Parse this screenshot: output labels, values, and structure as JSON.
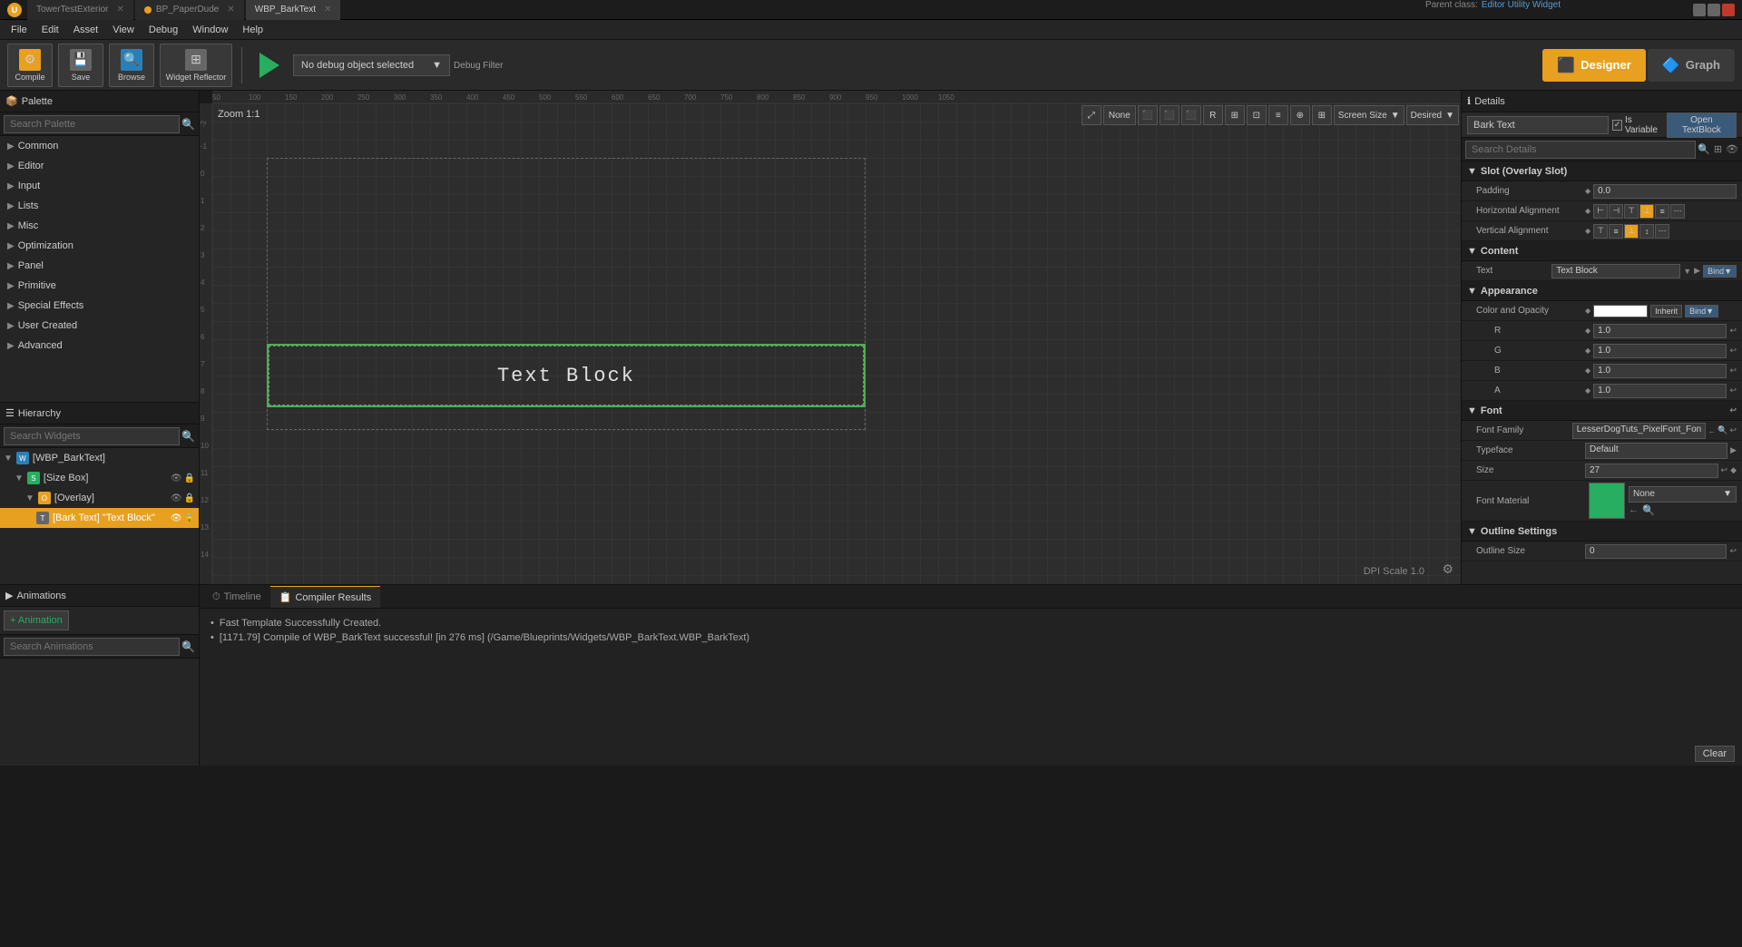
{
  "titlebar": {
    "logo": "U",
    "tabs": [
      {
        "label": "TowerTestExterior",
        "active": false,
        "has_dot": false
      },
      {
        "label": "BP_PaperDude",
        "active": false,
        "has_dot": true
      },
      {
        "label": "WBP_BarkText",
        "active": true,
        "has_dot": false
      }
    ]
  },
  "menubar": {
    "items": [
      "File",
      "Edit",
      "Asset",
      "View",
      "Debug",
      "Window",
      "Help"
    ]
  },
  "toolbar": {
    "compile_label": "Compile",
    "save_label": "Save",
    "browse_label": "Browse",
    "widget_reflector_label": "Widget Reflector",
    "play_label": "Play",
    "debug_filter_label": "Debug Filter",
    "debug_object": "No debug object selected",
    "designer_label": "Designer",
    "graph_label": "Graph",
    "parent_class_label": "Parent class:",
    "parent_class_value": "Editor Utility Widget"
  },
  "palette": {
    "header_label": "Palette",
    "search_placeholder": "Search Palette",
    "items": [
      {
        "label": "Common",
        "expanded": false
      },
      {
        "label": "Editor",
        "expanded": false
      },
      {
        "label": "Input",
        "expanded": false
      },
      {
        "label": "Lists",
        "expanded": false
      },
      {
        "label": "Misc",
        "expanded": false
      },
      {
        "label": "Optimization",
        "expanded": false
      },
      {
        "label": "Panel",
        "expanded": false
      },
      {
        "label": "Primitive",
        "expanded": false
      },
      {
        "label": "Special Effects",
        "expanded": false
      },
      {
        "label": "User Created",
        "expanded": false
      },
      {
        "label": "Advanced",
        "expanded": false
      }
    ]
  },
  "hierarchy": {
    "header_label": "Hierarchy",
    "search_placeholder": "Search Widgets",
    "items": [
      {
        "label": "[WBP_BarkText]",
        "indent": 0,
        "icon": "widget",
        "expanded": true
      },
      {
        "label": "[Size Box]",
        "indent": 1,
        "icon": "box",
        "expanded": true
      },
      {
        "label": "[Overlay]",
        "indent": 2,
        "icon": "overlay",
        "expanded": true
      },
      {
        "label": "[Bark Text] \"Text Block\"",
        "indent": 3,
        "icon": "text",
        "selected": true
      }
    ]
  },
  "canvas": {
    "zoom_label": "Zoom 1:1",
    "none_label": "None",
    "screen_size_label": "Screen Size",
    "desired_label": "Desired",
    "dpi_scale_label": "DPI Scale 1.0",
    "text_block_content": "Text Block"
  },
  "details": {
    "header_label": "Details",
    "name": "Bark Text",
    "is_variable_label": "Is Variable",
    "open_textblock_label": "Open TextBlock",
    "search_placeholder": "Search Details",
    "sections": {
      "slot": {
        "label": "Slot (Overlay Slot)",
        "padding_label": "Padding",
        "padding_value": "0.0",
        "h_align_label": "Horizontal Alignment",
        "v_align_label": "Vertical Alignment"
      },
      "content": {
        "label": "Content",
        "text_label": "Text",
        "text_value": "Text Block",
        "bind_label": "Bind▼"
      },
      "appearance": {
        "label": "Appearance",
        "color_opacity_label": "Color and Opacity",
        "inherit_label": "Inherit",
        "r_label": "R",
        "r_value": "1.0",
        "g_label": "G",
        "g_value": "1.0",
        "b_label": "B",
        "b_value": "1.0",
        "a_label": "A",
        "a_value": "1.0"
      },
      "font": {
        "label": "Font",
        "family_label": "Font Family",
        "family_value": "LesserDogTuts_PixelFont_Fon",
        "typeface_label": "Typeface",
        "typeface_value": "Default",
        "size_label": "Size",
        "size_value": "27",
        "material_label": "Font Material",
        "material_value": "None"
      },
      "outline": {
        "label": "Outline Settings",
        "size_label": "Outline Size",
        "size_value": "0"
      }
    }
  },
  "animations": {
    "header_label": "Animations",
    "add_label": "+ Animation",
    "search_placeholder": "Search Animations"
  },
  "bottom_tabs": {
    "timeline_label": "Timeline",
    "compiler_label": "Compiler Results",
    "messages": [
      {
        "text": "Fast Template Successfully Created.",
        "type": "normal"
      },
      {
        "text": "[1171.79] Compile of WBP_BarkText successful! [in 276 ms] (/Game/Blueprints/Widgets/WBP_BarkText.WBP_BarkText)",
        "type": "normal"
      }
    ],
    "clear_label": "Clear"
  }
}
